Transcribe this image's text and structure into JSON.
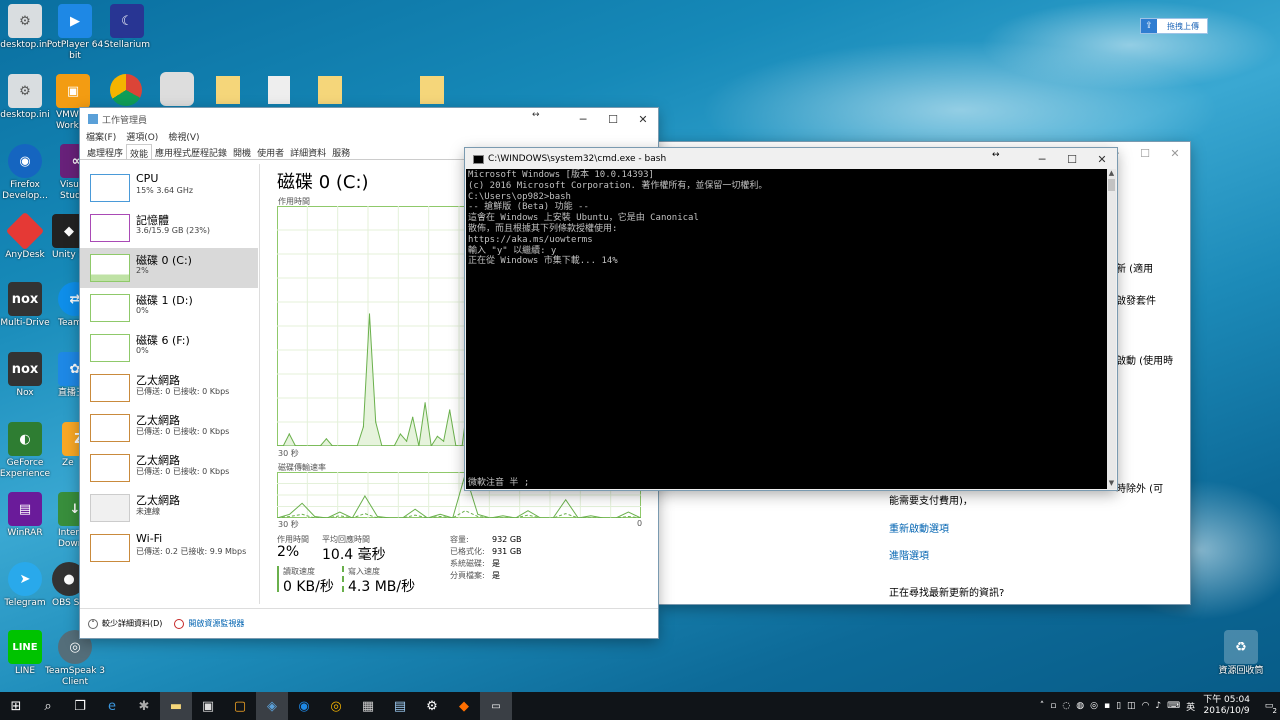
{
  "desktop_icons": [
    {
      "label": "desktop.ini",
      "icon": "settings-file-icon"
    },
    {
      "label": "PotPlayer 64 bit",
      "icon": "play-icon"
    },
    {
      "label": "Stellarium",
      "icon": "moon-icon"
    },
    {
      "label": "desktop.ini",
      "icon": "settings-file-icon"
    },
    {
      "label": "VMW Works",
      "icon": "vmware-icon"
    },
    {
      "label": "Firefox Develop...",
      "icon": "firefox-icon"
    },
    {
      "label": "Visu Studio",
      "icon": "visual-studio-icon"
    },
    {
      "label": "AnyDesk",
      "icon": "anydesk-icon"
    },
    {
      "label": "Unity 5 (64-",
      "icon": "unity-icon"
    },
    {
      "label": "Multi-Drive",
      "icon": "nox-icon"
    },
    {
      "label": "TeamV 1",
      "icon": "teamviewer-icon"
    },
    {
      "label": "Nox",
      "icon": "nox-icon"
    },
    {
      "label": "直播王",
      "icon": "broadcast-icon"
    },
    {
      "label": "GeForce Experience",
      "icon": "nvidia-icon"
    },
    {
      "label": "Ze",
      "icon": "zen-icon"
    },
    {
      "label": "WinRAR",
      "icon": "winrar-icon"
    },
    {
      "label": "Inter Down",
      "icon": "idm-icon"
    },
    {
      "label": "Telegram",
      "icon": "telegram-icon"
    },
    {
      "label": "OBS St",
      "icon": "obs-icon"
    },
    {
      "label": "LINE",
      "icon": "line-icon"
    },
    {
      "label": "TeamSpeak 3 Client",
      "icon": "teamspeak-icon"
    },
    {
      "label": "資源回收筒",
      "icon": "recycle-bin-icon"
    }
  ],
  "upload_widget": {
    "label": "拖拽上傳"
  },
  "task_manager": {
    "title": "工作管理員",
    "menu": [
      "檔案(F)",
      "選項(O)",
      "檢視(V)"
    ],
    "tabs": [
      "處理程序",
      "效能",
      "應用程式歷程記錄",
      "開機",
      "使用者",
      "詳細資料",
      "服務"
    ],
    "active_tab": "效能",
    "sidebar": [
      {
        "name": "CPU",
        "sub": "15% 3.64 GHz"
      },
      {
        "name": "記憶體",
        "sub": "3.6/15.9 GB (23%)"
      },
      {
        "name": "磁碟 0 (C:)",
        "sub": "2%"
      },
      {
        "name": "磁碟 1 (D:)",
        "sub": "0%"
      },
      {
        "name": "磁碟 6 (F:)",
        "sub": "0%"
      },
      {
        "name": "乙太網路",
        "sub": "已傳送: 0 已接收: 0 Kbps"
      },
      {
        "name": "乙太網路",
        "sub": "已傳送: 0 已接收: 0 Kbps"
      },
      {
        "name": "乙太網路",
        "sub": "已傳送: 0 已接收: 0 Kbps"
      },
      {
        "name": "乙太網路",
        "sub": "未連線"
      },
      {
        "name": "Wi-Fi",
        "sub": "已傳送: 0.2 已接收: 9.9 Mbps"
      }
    ],
    "main": {
      "heading": "磁碟 0 (C:)",
      "chart1_label": "作用時間",
      "chart1_time": "30 秒",
      "chart2_label": "磁碟傳輸速率",
      "chart2_time": "30 秒",
      "chart2_zero": "0",
      "active_time_label": "作用時間",
      "active_time_value": "2%",
      "avg_response_label": "平均回應時間",
      "avg_response_value": "10.4 毫秒",
      "read_label": "讀取速度",
      "read_value": "0 KB/秒",
      "write_label": "寫入速度",
      "write_value": "4.3 MB/秒",
      "props": [
        {
          "k": "容量:",
          "v": "932 GB"
        },
        {
          "k": "已格式化:",
          "v": "931 GB"
        },
        {
          "k": "系統磁碟:",
          "v": "是"
        },
        {
          "k": "分頁檔案:",
          "v": "是"
        }
      ]
    },
    "footer": {
      "fewer_details": "較少詳細資料(D)",
      "resource_monitor": "開啟資源監視器"
    }
  },
  "chart_data": [
    {
      "type": "area",
      "title": "作用時間",
      "xlabel": "30 秒",
      "x": [
        0,
        1,
        2,
        3,
        4,
        5,
        6,
        7,
        8,
        9,
        10,
        11,
        12,
        13,
        14,
        15,
        16,
        17,
        18,
        19,
        20,
        21,
        22,
        23,
        24,
        25,
        26,
        27,
        28,
        29,
        30,
        31,
        32,
        33,
        34,
        35,
        36,
        37,
        38,
        39,
        40,
        41,
        42,
        43,
        44,
        45,
        46,
        47,
        48,
        49,
        50,
        51,
        52,
        53,
        54,
        55,
        56,
        57,
        58,
        59
      ],
      "series": [
        {
          "values": [
            0,
            0,
            5,
            0,
            0,
            0,
            0,
            0,
            3,
            0,
            0,
            0,
            0,
            0,
            8,
            55,
            10,
            0,
            0,
            0,
            5,
            2,
            12,
            0,
            18,
            0,
            4,
            2,
            15,
            0,
            0,
            20,
            3,
            28,
            0,
            45,
            0,
            0,
            5,
            0,
            3,
            0,
            0,
            0,
            0,
            0,
            0,
            0,
            0,
            0,
            0,
            0,
            0,
            0,
            0,
            0,
            0,
            0,
            0,
            0
          ]
        }
      ],
      "ylim": [
        0,
        100
      ]
    },
    {
      "type": "line",
      "title": "磁碟傳輸速率",
      "xlabel": "30 秒",
      "x": [
        0,
        1,
        2,
        3,
        4,
        5,
        6,
        7,
        8,
        9,
        10,
        11,
        12,
        13,
        14,
        15,
        16,
        17,
        18,
        19,
        20,
        21,
        22,
        23,
        24,
        25,
        26,
        27,
        28,
        29
      ],
      "series": [
        {
          "values": [
            0,
            5,
            20,
            2,
            0,
            8,
            0,
            30,
            2,
            0,
            0,
            12,
            0,
            5,
            0,
            60,
            5,
            0,
            3,
            0,
            10,
            0,
            0,
            25,
            0,
            3,
            0,
            0,
            8,
            0
          ]
        },
        {
          "values": [
            0,
            2,
            5,
            0,
            0,
            3,
            0,
            6,
            0,
            0,
            0,
            4,
            0,
            2,
            0,
            10,
            2,
            0,
            0,
            0,
            4,
            0,
            0,
            6,
            0,
            0,
            0,
            0,
            2,
            0
          ]
        }
      ]
    }
  ],
  "cmd": {
    "title": "C:\\WINDOWS\\system32\\cmd.exe - bash",
    "lines": [
      "Microsoft Windows [版本 10.0.14393]",
      "(c) 2016 Microsoft Corporation. 著作權所有，並保留一切權利。",
      "",
      "C:\\Users\\op982>bash",
      "-- 搶鮮版 (Beta) 功能 --",
      "這會在 Windows 上安裝 Ubuntu，它是由 Canonical",
      "散佈，而且根據其下列條款授權使用:",
      "https://aka.ms/uowterms",
      "",
      "輸入 \"y\" 以繼續: y",
      "正在從 Windows 市集下載... 14%"
    ],
    "status_line": "微軟注音 半 ;"
  },
  "settings_window": {
    "text1": "新 (適用",
    "text2": "啟發套件",
    "text3": "啟動 (使用時",
    "text4": "時除外 (可",
    "text5": "能需要支付費用)，",
    "link1": "重新啟動選項",
    "link2": "進階選項",
    "question": "正在尋找最新更新的資訊?"
  },
  "taskbar": {
    "apps": [
      "start-icon",
      "search-icon",
      "task-view-icon",
      "edge-icon",
      "app-icon",
      "file-explorer-icon",
      "app-icon",
      "app-icon",
      "app-icon",
      "firefox-icon",
      "chrome-icon",
      "app-icon",
      "app-icon",
      "settings-icon",
      "app-icon",
      "cmd-icon"
    ],
    "ime": "英",
    "time": "下午 05:04",
    "date": "2016/10/9",
    "notif": "2"
  }
}
